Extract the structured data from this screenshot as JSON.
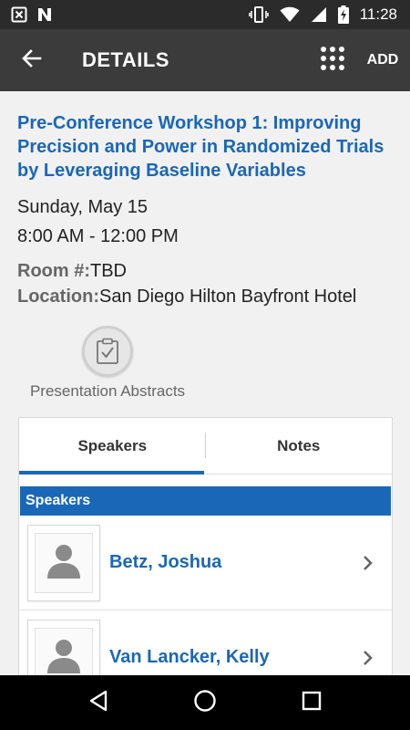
{
  "status_bar": {
    "time": "11:28",
    "icons": [
      "close-box-icon",
      "n-logo-icon",
      "vibrate-icon",
      "wifi-icon",
      "signal-icon",
      "battery-charging-icon"
    ]
  },
  "app_bar": {
    "title": "DETAILS",
    "add_label": "ADD",
    "back_icon": "arrow-left-icon",
    "grid_icon": "grid-dots-icon"
  },
  "session": {
    "title": "Pre-Conference Workshop 1: Improving Precision and Power in Randomized Trials by Leveraging Baseline Variables",
    "date": "Sunday, May 15",
    "time": "8:00 AM - 12:00 PM",
    "room_label": "Room #:",
    "room_value": "TBD",
    "location_label": "Location:",
    "location_value": "San Diego Hilton Bayfront Hotel"
  },
  "abstracts": {
    "label": "Presentation Abstracts",
    "icon": "clipboard-check-icon"
  },
  "tabs": [
    {
      "label": "Speakers",
      "active": true
    },
    {
      "label": "Notes",
      "active": false
    }
  ],
  "speakers_section": {
    "header": "Speakers",
    "items": [
      {
        "name": "Betz, Joshua"
      },
      {
        "name": "Van Lancker, Kelly"
      }
    ]
  },
  "nav_bar": {
    "icons": [
      "back-triangle-icon",
      "home-circle-icon",
      "recents-square-icon"
    ]
  },
  "colors": {
    "accent": "#1a67b8",
    "app_bar": "#3b3b3b",
    "status_bar": "#2b2b2b"
  }
}
